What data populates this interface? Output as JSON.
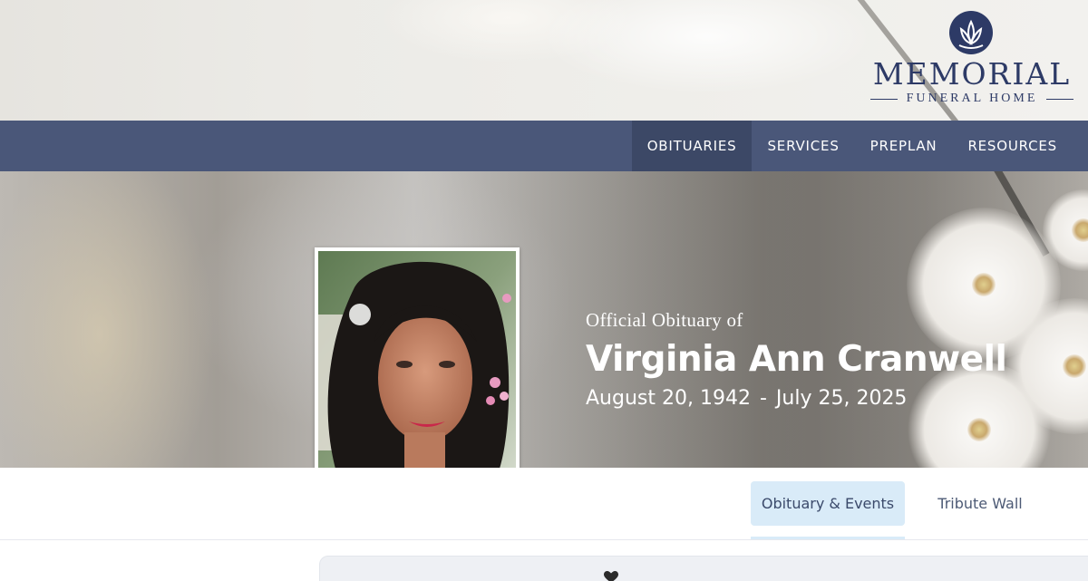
{
  "brand": {
    "name": "MEMORIAL",
    "subtitle": "FUNERAL HOME",
    "logo_icon": "lotus-leaf-icon",
    "brand_color": "#2d3a66"
  },
  "nav": {
    "items": [
      {
        "label": "OBITUARIES",
        "active": true
      },
      {
        "label": "SERVICES",
        "active": false
      },
      {
        "label": "PREPLAN",
        "active": false
      },
      {
        "label": "RESOURCES",
        "active": false
      }
    ],
    "bar_color": "#4a5779",
    "active_color": "#3c4866"
  },
  "hero": {
    "label": "Official Obituary of",
    "name": "Virginia Ann Cranwell",
    "birth_date": "August 20, 1942",
    "separator": "-",
    "death_date": "July 25, 2025",
    "portrait_icon": "portrait-photo"
  },
  "tabs": [
    {
      "label": "Obituary & Events",
      "active": true
    },
    {
      "label": "Tribute Wall",
      "active": false
    }
  ],
  "content": {
    "icon": "heart-icon"
  },
  "colors": {
    "tab_active_bg": "#d9ebf8",
    "tab_text": "#3b4a6b"
  }
}
